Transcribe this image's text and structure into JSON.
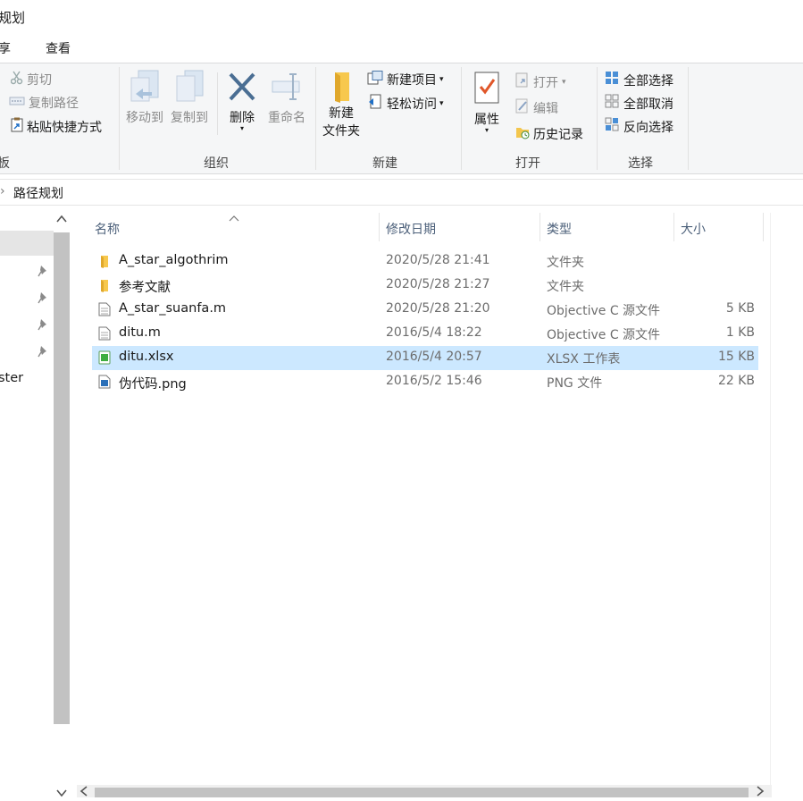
{
  "window": {
    "title": "规划"
  },
  "menu_tabs": [
    "享",
    "查看"
  ],
  "ribbon": {
    "clipboard": {
      "cut": "剪切",
      "copy_path": "复制路径",
      "paste_shortcut": "粘贴快捷方式",
      "group_label": "板"
    },
    "organize": {
      "move_to": "移动到",
      "copy_to": "复制到",
      "delete": "删除",
      "rename": "重命名",
      "group_label": "组织"
    },
    "new": {
      "new_item": "新建项目",
      "easy_access": "轻松访问",
      "new_folder_line1": "新建",
      "new_folder_line2": "文件夹",
      "group_label": "新建"
    },
    "open": {
      "properties": "属性",
      "open": "打开",
      "edit": "编辑",
      "history": "历史记录",
      "group_label": "打开"
    },
    "select": {
      "select_all": "全部选择",
      "select_none": "全部取消",
      "invert": "反向选择",
      "group_label": "选择"
    }
  },
  "address": {
    "chevron": "›",
    "path": "路径规划"
  },
  "nav": {
    "partial_item": "ster"
  },
  "columns": {
    "name": "名称",
    "modified": "修改日期",
    "type": "类型",
    "size": "大小"
  },
  "files": [
    {
      "name": "A_star_algothrim",
      "modified": "2020/5/28 21:41",
      "type": "文件夹",
      "size": "",
      "icon": "folder-icon"
    },
    {
      "name": "参考文献",
      "modified": "2020/5/28 21:27",
      "type": "文件夹",
      "size": "",
      "icon": "folder-icon"
    },
    {
      "name": "A_star_suanfa.m",
      "modified": "2020/5/28 21:20",
      "type": "Objective C 源文件",
      "size": "5 KB",
      "icon": "document-icon"
    },
    {
      "name": "ditu.m",
      "modified": "2016/5/4 18:22",
      "type": "Objective C 源文件",
      "size": "1 KB",
      "icon": "document-icon"
    },
    {
      "name": "ditu.xlsx",
      "modified": "2016/5/4 20:57",
      "type": "XLSX 工作表",
      "size": "15 KB",
      "icon": "spreadsheet-icon"
    },
    {
      "name": "伪代码.png",
      "modified": "2016/5/2 15:46",
      "type": "PNG 文件",
      "size": "22 KB",
      "icon": "image-file-icon"
    }
  ],
  "selected_row": 4
}
